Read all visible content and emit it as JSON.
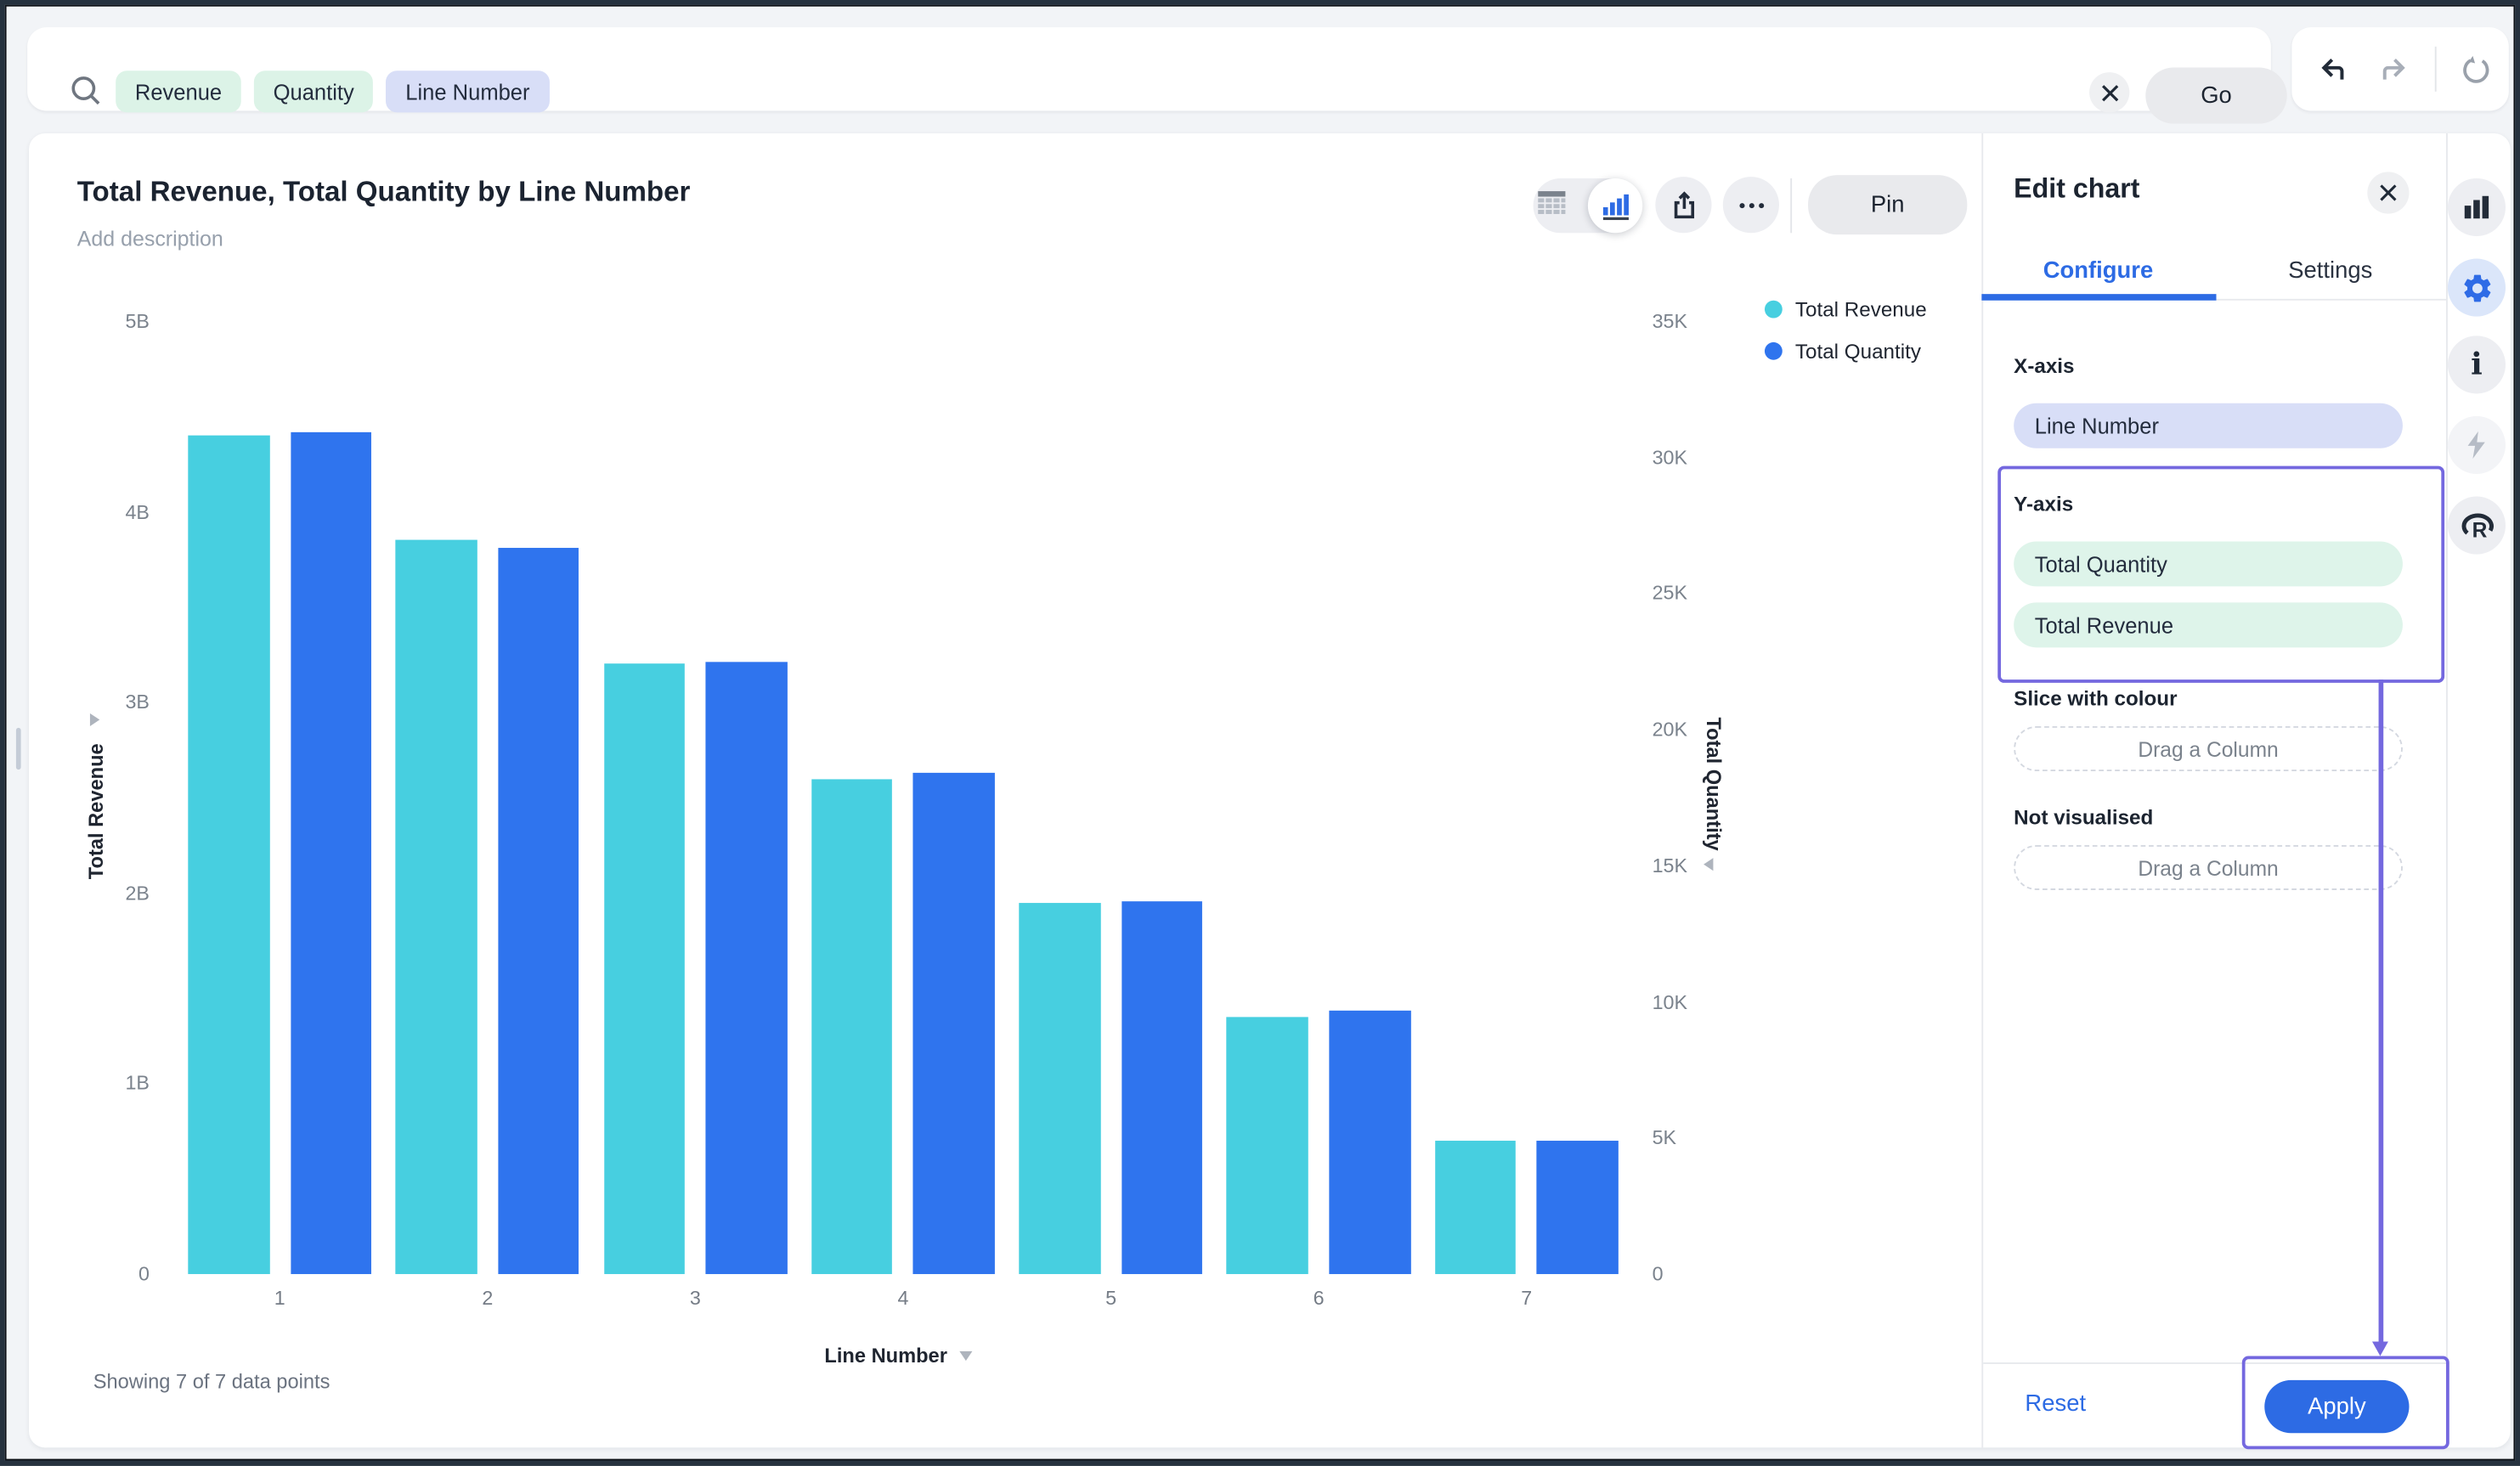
{
  "topbar": {
    "chips": [
      {
        "label": "Revenue",
        "tone": "mint"
      },
      {
        "label": "Quantity",
        "tone": "mint"
      },
      {
        "label": "Line Number",
        "tone": "periwinkle"
      }
    ],
    "go_label": "Go"
  },
  "chart_header": {
    "title": "Total Revenue, Total Quantity by Line Number",
    "description_placeholder": "Add description",
    "pin_label": "Pin"
  },
  "legend": [
    {
      "label": "Total Revenue",
      "color": "#47CFE0"
    },
    {
      "label": "Total Quantity",
      "color": "#2F74EE"
    }
  ],
  "chart_data": {
    "type": "bar",
    "categories": [
      "1",
      "2",
      "3",
      "4",
      "5",
      "6",
      "7"
    ],
    "series": [
      {
        "name": "Total Revenue",
        "axis": "left",
        "color": "#47CFE0",
        "unit": "billions",
        "values": [
          4.4,
          3.85,
          3.2,
          2.6,
          1.95,
          1.35,
          0.7
        ]
      },
      {
        "name": "Total Quantity",
        "axis": "right",
        "color": "#2F74EE",
        "unit": "thousands",
        "values": [
          30.9,
          26.7,
          22.5,
          18.4,
          13.7,
          9.7,
          4.9
        ]
      }
    ],
    "left_axis": {
      "title": "Total Revenue",
      "ticks": [
        "0",
        "1B",
        "2B",
        "3B",
        "4B",
        "5B"
      ],
      "tick_values": [
        0,
        1,
        2,
        3,
        4,
        5
      ],
      "max": 5
    },
    "right_axis": {
      "title": "Total Quantity",
      "ticks": [
        "0",
        "5K",
        "10K",
        "15K",
        "20K",
        "25K",
        "30K",
        "35K"
      ],
      "tick_values": [
        0,
        5,
        10,
        15,
        20,
        25,
        30,
        35
      ],
      "max": 35
    },
    "xlabel": "Line Number",
    "footer": "Showing 7 of 7 data points",
    "grid": false,
    "legend_position": "top-right"
  },
  "edit_panel": {
    "title": "Edit chart",
    "tabs": [
      {
        "label": "Configure",
        "active": true
      },
      {
        "label": "Settings",
        "active": false
      }
    ],
    "x_axis": {
      "label": "X-axis",
      "chips": [
        "Line Number"
      ]
    },
    "y_axis": {
      "label": "Y-axis",
      "chips": [
        "Total Quantity",
        "Total Revenue"
      ]
    },
    "slice": {
      "label": "Slice with colour",
      "placeholder": "Drag a Column"
    },
    "not_visualised": {
      "label": "Not visualised",
      "placeholder": "Drag a Column"
    },
    "footer": {
      "reset_label": "Reset",
      "apply_label": "Apply"
    }
  },
  "rail": {
    "icons": [
      "bar-chart-icon",
      "settings-gear-icon",
      "info-icon",
      "lightning-icon",
      "r-logo-icon"
    ]
  },
  "colors": {
    "cyan": "#47CFE0",
    "blue": "#2F74EE",
    "accent": "#2D6BE4",
    "annotation_purple": "#7468DF",
    "chip_mint": "#DCF3E7",
    "chip_periwinkle": "#D8DEF7"
  }
}
